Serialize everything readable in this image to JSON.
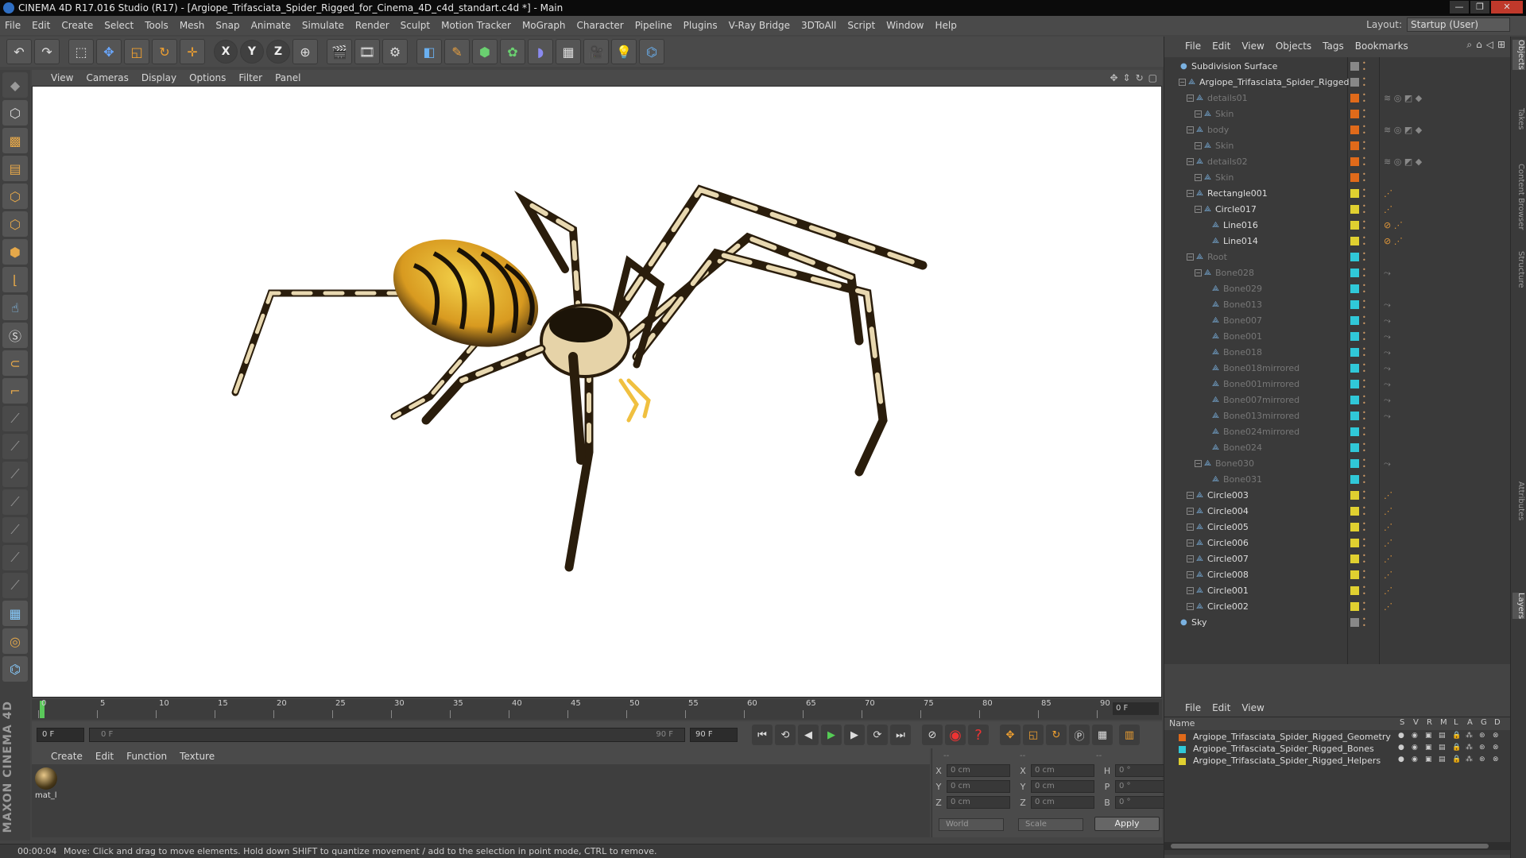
{
  "window": {
    "title": "CINEMA 4D R17.016 Studio (R17) - [Argiope_Trifasciata_Spider_Rigged_for_Cinema_4D_c4d_standart.c4d *] - Main",
    "controls": [
      "—",
      "❐",
      "✕"
    ]
  },
  "menubar": {
    "items": [
      "File",
      "Edit",
      "Create",
      "Select",
      "Tools",
      "Mesh",
      "Snap",
      "Animate",
      "Simulate",
      "Render",
      "Sculpt",
      "Motion Tracker",
      "MoGraph",
      "Character",
      "Pipeline",
      "Plugins",
      "V-Ray Bridge",
      "3DToAll",
      "Script",
      "Window",
      "Help"
    ],
    "layout_label": "Layout:",
    "layout_value": "Startup (User)"
  },
  "toolbar": {
    "icons": [
      "undo-icon",
      "redo-icon",
      "live-select-icon",
      "move-icon",
      "scale-icon",
      "rotate-icon",
      "recent-tool-icon",
      "x-axis-icon",
      "y-axis-icon",
      "z-axis-icon",
      "world-coords-icon",
      "render-view-icon",
      "render-picture-viewer-icon",
      "edit-render-settings-icon",
      "cube-icon",
      "pen-spline-icon",
      "subdivision-icon",
      "array-icon",
      "deformer-icon",
      "floor-icon",
      "camera-icon",
      "light-icon",
      "python-icon"
    ],
    "axis_labels": [
      "X",
      "Y",
      "Z"
    ]
  },
  "viewport_menu": {
    "items": [
      "View",
      "Cameras",
      "Display",
      "Options",
      "Filter",
      "Panel"
    ]
  },
  "timeline": {
    "ticks": [
      "0",
      "5",
      "10",
      "15",
      "20",
      "25",
      "30",
      "35",
      "40",
      "45",
      "50",
      "55",
      "60",
      "65",
      "70",
      "75",
      "80",
      "85",
      "90"
    ],
    "current_frame": "0 F"
  },
  "playback": {
    "start_field": "0 F",
    "slider_start": "0 F",
    "slider_end": "90 F",
    "end_field": "90 F"
  },
  "material_menu": {
    "items": [
      "Create",
      "Edit",
      "Function",
      "Texture"
    ],
    "material_name": "mat_l"
  },
  "coordinates": {
    "headers": [
      "--",
      "--",
      "--"
    ],
    "rows": [
      {
        "a": "X",
        "av": "0 cm",
        "b": "X",
        "bv": "0 cm",
        "c": "H",
        "cv": "0 °"
      },
      {
        "a": "Y",
        "av": "0 cm",
        "b": "Y",
        "bv": "0 cm",
        "c": "P",
        "cv": "0 °"
      },
      {
        "a": "Z",
        "av": "0 cm",
        "b": "Z",
        "bv": "0 cm",
        "c": "B",
        "cv": "0 °"
      }
    ],
    "dropdown1": "World",
    "dropdown2": "Scale",
    "apply_label": "Apply"
  },
  "statusbar": {
    "time": "00:00:04",
    "message": "Move: Click and drag to move elements. Hold down SHIFT to quantize movement / add to the selection in point mode, CTRL to remove."
  },
  "object_manager": {
    "menu": [
      "File",
      "Edit",
      "View",
      "Objects",
      "Tags",
      "Bookmarks"
    ],
    "tree": [
      {
        "name": "Subdivision Surface",
        "depth": 0,
        "color": "#888888",
        "dim": false,
        "tag": ""
      },
      {
        "name": "Argiope_Trifasciata_Spider_Rigged",
        "depth": 1,
        "color": "#888888",
        "dim": false,
        "tag": ""
      },
      {
        "name": "details01",
        "depth": 2,
        "color": "#e06a1a",
        "dim": true,
        "tag": "≋ ◎ ◩ ◆"
      },
      {
        "name": "Skin",
        "depth": 3,
        "color": "#e06a1a",
        "dim": true,
        "tag": ""
      },
      {
        "name": "body",
        "depth": 2,
        "color": "#e06a1a",
        "dim": true,
        "tag": "≋ ◎ ◩ ◆"
      },
      {
        "name": "Skin",
        "depth": 3,
        "color": "#e06a1a",
        "dim": true,
        "tag": ""
      },
      {
        "name": "details02",
        "depth": 2,
        "color": "#e06a1a",
        "dim": true,
        "tag": "≋ ◎ ◩ ◆"
      },
      {
        "name": "Skin",
        "depth": 3,
        "color": "#e06a1a",
        "dim": true,
        "tag": ""
      },
      {
        "name": "Rectangle001",
        "depth": 2,
        "color": "#e0d030",
        "dim": false,
        "tag": "⋰"
      },
      {
        "name": "Circle017",
        "depth": 3,
        "color": "#e0d030",
        "dim": false,
        "tag": "⋰"
      },
      {
        "name": "Line016",
        "depth": 4,
        "color": "#e0d030",
        "dim": false,
        "tag": "⊘ ⋰"
      },
      {
        "name": "Line014",
        "depth": 4,
        "color": "#e0d030",
        "dim": false,
        "tag": "⊘ ⋰"
      },
      {
        "name": "Root",
        "depth": 2,
        "color": "#30c8d8",
        "dim": true,
        "tag": ""
      },
      {
        "name": "Bone028",
        "depth": 3,
        "color": "#30c8d8",
        "dim": true,
        "tag": "⤳"
      },
      {
        "name": "Bone029",
        "depth": 4,
        "color": "#30c8d8",
        "dim": true,
        "tag": ""
      },
      {
        "name": "Bone013",
        "depth": 4,
        "color": "#30c8d8",
        "dim": true,
        "tag": "⤳"
      },
      {
        "name": "Bone007",
        "depth": 4,
        "color": "#30c8d8",
        "dim": true,
        "tag": "⤳"
      },
      {
        "name": "Bone001",
        "depth": 4,
        "color": "#30c8d8",
        "dim": true,
        "tag": "⤳"
      },
      {
        "name": "Bone018",
        "depth": 4,
        "color": "#30c8d8",
        "dim": true,
        "tag": "⤳"
      },
      {
        "name": "Bone018mirrored",
        "depth": 4,
        "color": "#30c8d8",
        "dim": true,
        "tag": "⤳"
      },
      {
        "name": "Bone001mirrored",
        "depth": 4,
        "color": "#30c8d8",
        "dim": true,
        "tag": "⤳"
      },
      {
        "name": "Bone007mirrored",
        "depth": 4,
        "color": "#30c8d8",
        "dim": true,
        "tag": "⤳"
      },
      {
        "name": "Bone013mirrored",
        "depth": 4,
        "color": "#30c8d8",
        "dim": true,
        "tag": "⤳"
      },
      {
        "name": "Bone024mirrored",
        "depth": 4,
        "color": "#30c8d8",
        "dim": true,
        "tag": ""
      },
      {
        "name": "Bone024",
        "depth": 4,
        "color": "#30c8d8",
        "dim": true,
        "tag": ""
      },
      {
        "name": "Bone030",
        "depth": 3,
        "color": "#30c8d8",
        "dim": true,
        "tag": "⤳"
      },
      {
        "name": "Bone031",
        "depth": 4,
        "color": "#30c8d8",
        "dim": true,
        "tag": ""
      },
      {
        "name": "Circle003",
        "depth": 2,
        "color": "#e0d030",
        "dim": false,
        "tag": "⋰"
      },
      {
        "name": "Circle004",
        "depth": 2,
        "color": "#e0d030",
        "dim": false,
        "tag": "⋰"
      },
      {
        "name": "Circle005",
        "depth": 2,
        "color": "#e0d030",
        "dim": false,
        "tag": "⋰"
      },
      {
        "name": "Circle006",
        "depth": 2,
        "color": "#e0d030",
        "dim": false,
        "tag": "⋰"
      },
      {
        "name": "Circle007",
        "depth": 2,
        "color": "#e0d030",
        "dim": false,
        "tag": "⋰"
      },
      {
        "name": "Circle008",
        "depth": 2,
        "color": "#e0d030",
        "dim": false,
        "tag": "⋰"
      },
      {
        "name": "Circle001",
        "depth": 2,
        "color": "#e0d030",
        "dim": false,
        "tag": "⋰"
      },
      {
        "name": "Circle002",
        "depth": 2,
        "color": "#e0d030",
        "dim": false,
        "tag": "⋰"
      },
      {
        "name": "Sky",
        "depth": 0,
        "color": "#888888",
        "dim": false,
        "tag": ""
      }
    ]
  },
  "layer_manager": {
    "menu": [
      "File",
      "Edit",
      "View"
    ],
    "header_name": "Name",
    "columns": [
      "S",
      "V",
      "R",
      "M",
      "L",
      "A",
      "G",
      "D"
    ],
    "layers": [
      {
        "name": "Argiope_Trifasciata_Spider_Rigged_Geometry",
        "color": "#e06a1a"
      },
      {
        "name": "Argiope_Trifasciata_Spider_Rigged_Bones",
        "color": "#30c8d8"
      },
      {
        "name": "Argiope_Trifasciata_Spider_Rigged_Helpers",
        "color": "#e0d030"
      }
    ]
  },
  "side_tabs": [
    "Objects",
    "Takes",
    "Content Browser",
    "Structure",
    "Attributes",
    "Layers"
  ]
}
